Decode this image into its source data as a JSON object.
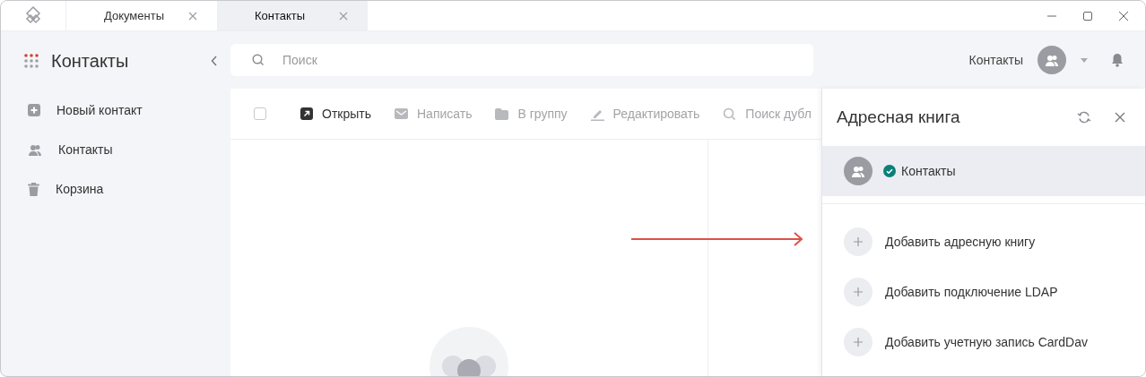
{
  "tabs": [
    {
      "label": "Документы",
      "selected": false
    },
    {
      "label": "Контакты",
      "selected": true
    }
  ],
  "sidebar": {
    "title": "Контакты",
    "items": [
      {
        "label": "Новый контакт",
        "kind": "add"
      },
      {
        "label": "Контакты",
        "kind": "people"
      },
      {
        "label": "Корзина",
        "kind": "trash"
      }
    ]
  },
  "search": {
    "placeholder": "Поиск"
  },
  "account": {
    "label": "Контакты"
  },
  "toolbar": {
    "select_all_checked": false,
    "actions": [
      {
        "label": "Открыть",
        "kind": "open",
        "disabled": false
      },
      {
        "label": "Написать",
        "kind": "mail",
        "disabled": true
      },
      {
        "label": "В группу",
        "kind": "folder",
        "disabled": true
      },
      {
        "label": "Редактировать",
        "kind": "edit",
        "disabled": true
      },
      {
        "label": "Поиск дубл",
        "kind": "search",
        "disabled": true
      }
    ]
  },
  "address_book": {
    "title": "Адресная книга",
    "books": [
      {
        "name": "Контакты",
        "selected": true,
        "synced": true
      }
    ],
    "add_actions": [
      {
        "label": "Добавить адресную книгу"
      },
      {
        "label": "Добавить подключение LDAP"
      },
      {
        "label": "Добавить учетную запись CardDav"
      }
    ]
  }
}
